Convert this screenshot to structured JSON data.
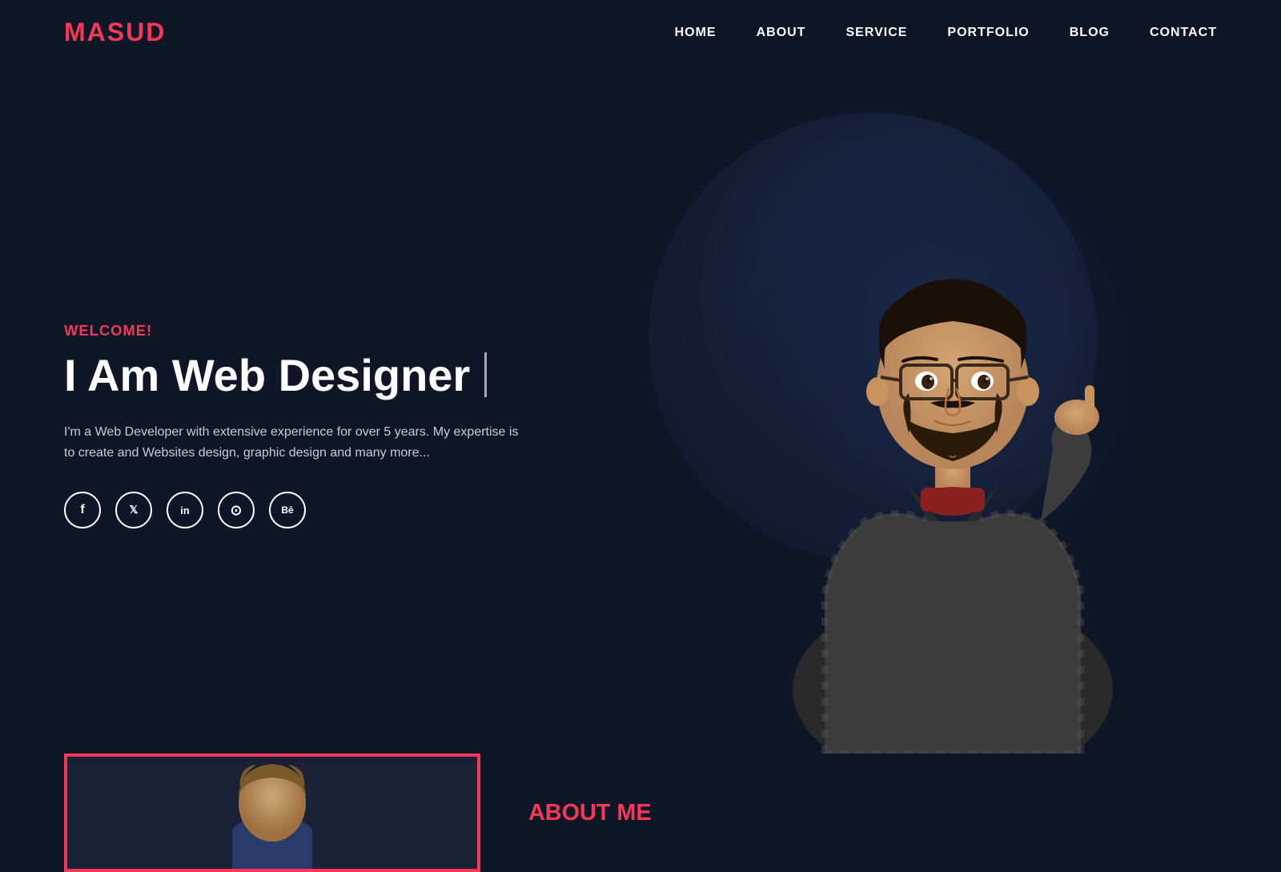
{
  "brand": {
    "logo": "MASUD"
  },
  "nav": {
    "links": [
      {
        "id": "home",
        "label": "HOME"
      },
      {
        "id": "about",
        "label": "ABOUT"
      },
      {
        "id": "service",
        "label": "SERVICE"
      },
      {
        "id": "portfolio",
        "label": "PORTFOLIO"
      },
      {
        "id": "blog",
        "label": "BLOG"
      },
      {
        "id": "contact",
        "label": "CONTACT"
      }
    ]
  },
  "hero": {
    "welcome_prefix": "WELCOME",
    "welcome_suffix": "!",
    "title": "I Am Web Designer",
    "description": "I'm a Web Developer with extensive experience for over 5 years. My expertise is to create and Websites design, graphic design and many more...",
    "social": [
      {
        "id": "facebook",
        "icon": "f",
        "label": "Facebook"
      },
      {
        "id": "twitter",
        "icon": "𝕏",
        "label": "Twitter"
      },
      {
        "id": "linkedin",
        "icon": "in",
        "label": "LinkedIn"
      },
      {
        "id": "instagram",
        "icon": "⊙",
        "label": "Instagram"
      },
      {
        "id": "behance",
        "icon": "Bē",
        "label": "Behance"
      }
    ]
  },
  "about": {
    "heading_prefix": "ABOUT ",
    "heading_suffix": "ME"
  }
}
